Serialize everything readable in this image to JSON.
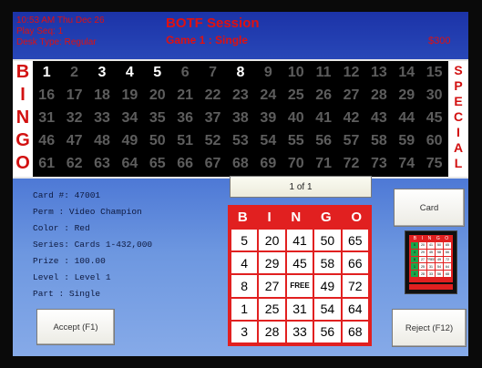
{
  "header": {
    "datetime": "10:53 AM Thu Dec 26",
    "play_seq": "Play Seq: 1",
    "desk_type": "Desk Type: Regular",
    "session_title": "BOTF Session",
    "game_title": "Game 1 : Single",
    "prize_display": "$300"
  },
  "board": {
    "left_letters": [
      "B",
      "I",
      "N",
      "G",
      "O"
    ],
    "right_letters": [
      "S",
      "P",
      "E",
      "C",
      "I",
      "A",
      "L"
    ],
    "rows": [
      [
        1,
        2,
        3,
        4,
        5,
        6,
        7,
        8,
        9,
        10,
        11,
        12,
        13,
        14,
        15
      ],
      [
        16,
        17,
        18,
        19,
        20,
        21,
        22,
        23,
        24,
        25,
        26,
        27,
        28,
        29,
        30
      ],
      [
        31,
        32,
        33,
        34,
        35,
        36,
        37,
        38,
        39,
        40,
        41,
        42,
        43,
        44,
        45
      ],
      [
        46,
        47,
        48,
        49,
        50,
        51,
        52,
        53,
        54,
        55,
        56,
        57,
        58,
        59,
        60
      ],
      [
        61,
        62,
        63,
        64,
        65,
        66,
        67,
        68,
        69,
        70,
        71,
        72,
        73,
        74,
        75
      ]
    ],
    "called": [
      1,
      3,
      4,
      5,
      8
    ],
    "colors": {
      "called": "#ffffff",
      "uncalled": "#5d5d5d",
      "letters": "#d21010"
    }
  },
  "info": {
    "card_number": "Card #: 47001",
    "perm": "Perm  : Video Champion",
    "color": "Color : Red",
    "series": "Series: Cards 1-432,000",
    "prize": "Prize : 100.00",
    "level": "Level : Level 1",
    "part": "Part  : Single"
  },
  "pagination": {
    "label": "1 of 1"
  },
  "card": {
    "headers": [
      "B",
      "I",
      "N",
      "G",
      "O"
    ],
    "rows": [
      [
        "5",
        "20",
        "41",
        "50",
        "65"
      ],
      [
        "4",
        "29",
        "45",
        "58",
        "66"
      ],
      [
        "8",
        "27",
        "FREE",
        "49",
        "72"
      ],
      [
        "1",
        "25",
        "31",
        "54",
        "64"
      ],
      [
        "3",
        "28",
        "33",
        "56",
        "68"
      ]
    ],
    "color": "#e12020"
  },
  "buttons": {
    "card": "Card",
    "accept": "Accept (F1)",
    "reject": "Reject (F12)"
  },
  "thumbnail": {
    "headers": [
      "B",
      "I",
      "N",
      "G",
      "O"
    ],
    "rows": [
      [
        "5",
        "20",
        "41",
        "50",
        "65"
      ],
      [
        "4",
        "29",
        "45",
        "58",
        "66"
      ],
      [
        "8",
        "27",
        "FREE",
        "49",
        "72"
      ],
      [
        "1",
        "25",
        "31",
        "54",
        "64"
      ],
      [
        "3",
        "28",
        "33",
        "56",
        "68"
      ]
    ],
    "highlight_color": "#1aa64a"
  }
}
